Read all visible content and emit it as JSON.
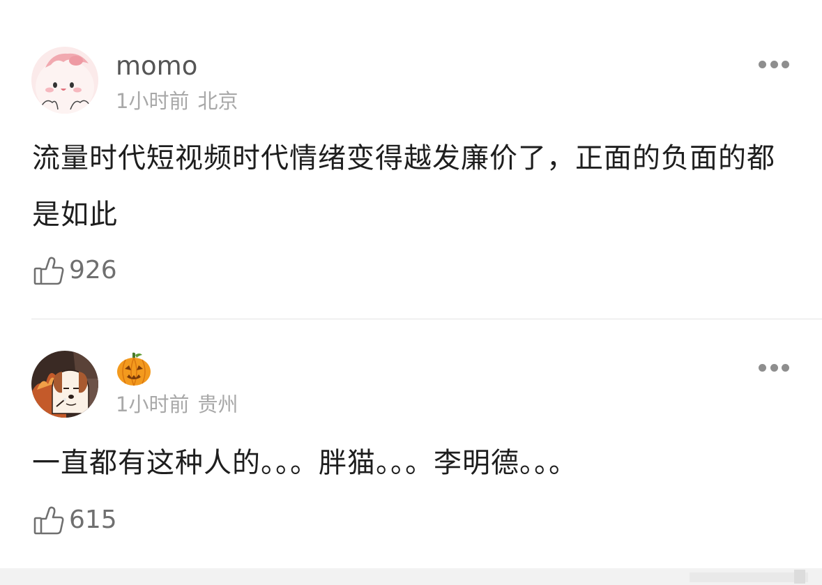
{
  "comments": [
    {
      "username": "momo",
      "time": "1小时前",
      "location": "北京",
      "text": "流量时代短视频时代情绪变得越发廉价了，正面的负面的都是如此",
      "likes": "926"
    },
    {
      "username": "🎃",
      "time": "1小时前",
      "location": "贵州",
      "text": "一直都有这种人的。。。胖猫。。。李明德。。。",
      "likes": "615"
    }
  ],
  "icons": {
    "like": "thumbs-up-icon",
    "more": "more-dots-icon"
  }
}
